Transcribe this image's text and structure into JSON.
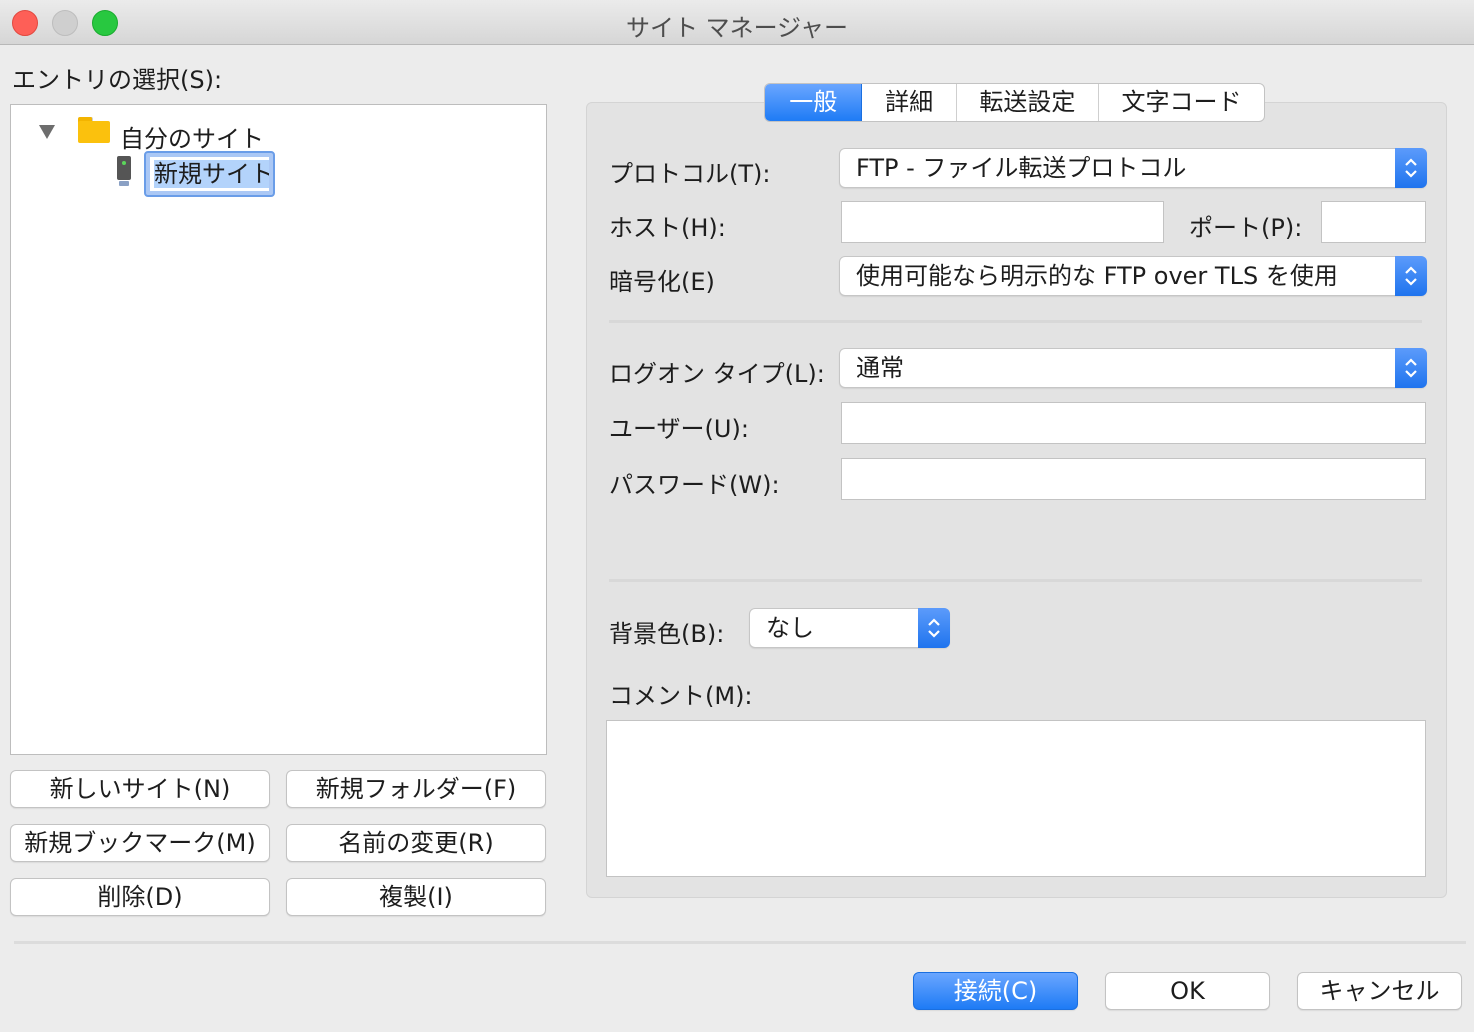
{
  "window": {
    "title": "サイト マネージャー"
  },
  "left": {
    "entry_label": "エントリの選択(S):",
    "tree": {
      "folder_label": "自分のサイト",
      "site_label": "新規サイト"
    },
    "buttons": {
      "new_site": "新しいサイト(N)",
      "new_folder": "新規フォルダー(F)",
      "new_bookmark": "新規ブックマーク(M)",
      "rename": "名前の変更(R)",
      "delete": "削除(D)",
      "duplicate": "複製(I)"
    }
  },
  "tabs": [
    "一般",
    "詳細",
    "転送設定",
    "文字コード"
  ],
  "general": {
    "protocol_label": "プロトコル(T):",
    "protocol_value": "FTP - ファイル転送プロトコル",
    "host_label": "ホスト(H):",
    "host_value": "",
    "port_label": "ポート(P):",
    "port_value": "",
    "encryption_label": "暗号化(E)",
    "encryption_value": "使用可能なら明示的な FTP over TLS を使用",
    "logon_type_label": "ログオン タイプ(L):",
    "logon_type_value": "通常",
    "user_label": "ユーザー(U):",
    "user_value": "",
    "password_label": "パスワード(W):",
    "password_value": "",
    "background_label": "背景色(B):",
    "background_value": "なし",
    "comment_label": "コメント(M):",
    "comment_value": ""
  },
  "footer": {
    "connect": "接続(C)",
    "ok": "OK",
    "cancel": "キャンセル"
  },
  "colors": {
    "accent": "#1e7bf5",
    "selection": "#abc8f5",
    "folder": "#fbc10d"
  }
}
